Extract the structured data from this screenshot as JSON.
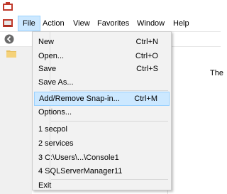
{
  "menubar": {
    "items": [
      "File",
      "Action",
      "View",
      "Favorites",
      "Window",
      "Help"
    ]
  },
  "file_menu": {
    "items": [
      {
        "label": "New",
        "shortcut": "Ctrl+N"
      },
      {
        "label": "Open...",
        "shortcut": "Ctrl+O"
      },
      {
        "label": "Save",
        "shortcut": "Ctrl+S"
      },
      {
        "label": "Save As...",
        "shortcut": ""
      },
      {
        "label": "Add/Remove Snap-in...",
        "shortcut": "Ctrl+M"
      },
      {
        "label": "Options...",
        "shortcut": ""
      },
      {
        "label": "1 secpol",
        "shortcut": ""
      },
      {
        "label": "2 services",
        "shortcut": ""
      },
      {
        "label": "3 C:\\Users\\...\\Console1",
        "shortcut": ""
      },
      {
        "label": "4 SQLServerManager11",
        "shortcut": ""
      },
      {
        "label": "Exit",
        "shortcut": ""
      }
    ]
  },
  "content": {
    "partial_text": "The"
  },
  "colors": {
    "highlight": "#cce8ff",
    "highlight_border": "#99d1ff",
    "menu_bg": "#f2f2f2"
  }
}
